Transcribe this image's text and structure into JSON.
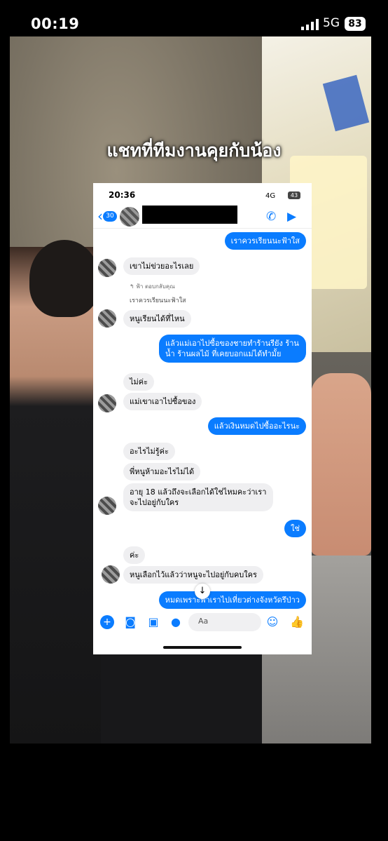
{
  "status_bar": {
    "time": "00:19",
    "network": "5G",
    "battery": "83"
  },
  "caption": "แชทที่ทีมงานคุยกับน้อง",
  "inner_screenshot": {
    "status": {
      "time": "20:36",
      "network": "4G",
      "battery": "43"
    },
    "header": {
      "back_badge": "30"
    },
    "messages": [
      {
        "id": "m1",
        "side": "out",
        "text": "เราควรเรียนนะฟ้าใส"
      },
      {
        "id": "m2",
        "side": "in",
        "text": "เขาไม่ข่วยอะไรเลย"
      },
      {
        "id": "m3_note",
        "text": "↰ ฟ้า ตอบกลับคุณ"
      },
      {
        "id": "m3_quote",
        "text": "เราควรเรียนนะฟ้าใส"
      },
      {
        "id": "m3",
        "side": "in",
        "text": "หนูเรียนได้ที่ไหน"
      },
      {
        "id": "m4",
        "side": "out",
        "text": "แล้วแม่เอาไปซื้อของชายทำร้านรียัง ร้านน้ำ ร้านผลไม้ ที่เคยบอกแม่ได้ทำมั้ย"
      },
      {
        "id": "m5",
        "side": "in",
        "text": "ไม่ค่ะ"
      },
      {
        "id": "m6",
        "side": "in",
        "text": "แม่เขาเอาไปซื้อของ"
      },
      {
        "id": "m7",
        "side": "out",
        "text": "แล้วเงินหมดไปซื้ออะไรนะ"
      },
      {
        "id": "m8",
        "side": "in",
        "text": "อะไรไม่รู้ค่ะ"
      },
      {
        "id": "m9",
        "side": "in",
        "text": "พี่หนูห้ามอะไรไม่ได้"
      },
      {
        "id": "m10",
        "side": "in",
        "text": "อายุ 18 แล้วถึงจะเลือกได้ใช่ไหมคะว่าเราจะไปอยู่กับใคร"
      },
      {
        "id": "m11",
        "side": "out",
        "text": "ใช่"
      },
      {
        "id": "m12",
        "side": "in",
        "text": "ค่ะ"
      },
      {
        "id": "m13",
        "side": "in",
        "text": "หนูเลือกไว้แล้วว่าหนูจะไปอยู่กับคบใคร"
      },
      {
        "id": "m14",
        "side": "out",
        "text": "หมดเพราะพาเราไปเที่ยวต่างจังหวัดรึป่าว"
      }
    ],
    "composer": {
      "placeholder": "Aa"
    },
    "icons": {
      "back": "chevron-left-icon",
      "call": "phone-icon",
      "video": "video-camera-icon",
      "plus": "plus-icon",
      "camera": "camera-icon",
      "gallery": "image-icon",
      "mic": "microphone-icon",
      "emoji": "emoji-icon",
      "like": "thumbs-up-icon",
      "scroll": "arrow-down-icon"
    },
    "colors": {
      "accent": "#0a7cff",
      "incoming_bubble": "#efeff1"
    }
  }
}
